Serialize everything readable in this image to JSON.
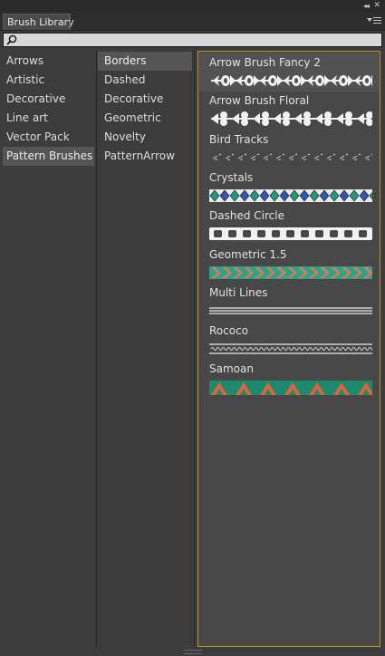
{
  "panel": {
    "tab_label": "Brush Library",
    "collapse_glyph": "◂◂",
    "close_glyph": "✕",
    "menu_icon": "panel-menu-icon",
    "search": {
      "value": "",
      "placeholder": "",
      "icon": "search-icon"
    }
  },
  "categories": [
    {
      "label": "Arrows"
    },
    {
      "label": "Artistic"
    },
    {
      "label": "Decorative"
    },
    {
      "label": "Line art"
    },
    {
      "label": "Vector Pack"
    },
    {
      "label": "Pattern Brushes",
      "selected": true
    }
  ],
  "subcategories": [
    {
      "label": "Borders",
      "selected": true
    },
    {
      "label": "Dashed"
    },
    {
      "label": "Decorative"
    },
    {
      "label": "Geometric"
    },
    {
      "label": "Novelty"
    },
    {
      "label": "PatternArrow"
    }
  ],
  "brushes": [
    {
      "name": "Arrow Brush Fancy 2",
      "preview": "fancy-arrow",
      "selected": true
    },
    {
      "name": "Arrow Brush Floral",
      "preview": "floral-arrow"
    },
    {
      "name": "Bird Tracks",
      "preview": "bird-tracks"
    },
    {
      "name": "Crystals",
      "preview": "crystals"
    },
    {
      "name": "Dashed Circle",
      "preview": "dashed-circle"
    },
    {
      "name": "Geometric 1.5",
      "preview": "chevron"
    },
    {
      "name": "Multi Lines",
      "preview": "multi-lines"
    },
    {
      "name": "Rococo",
      "preview": "rococo"
    },
    {
      "name": "Samoan",
      "preview": "samoan"
    }
  ],
  "colors": {
    "highlight_border": "#c0902e",
    "crystal_teal": "#1f9a82",
    "crystal_blue": "#2f57b3",
    "chevron_salmon": "#e8735a",
    "chevron_teal": "#2aa58a",
    "samoan_green": "#1d8a6e",
    "samoan_orange": "#e0643a"
  }
}
